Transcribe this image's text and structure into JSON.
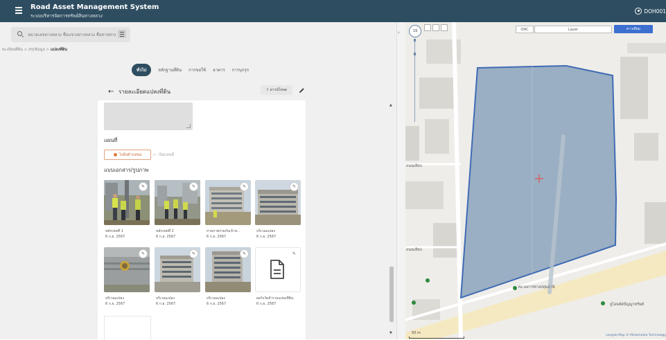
{
  "header": {
    "title": "Road Asset Management System",
    "subtitle": "ระบบบริหารจัดการทรัพย์สินทางหลวง",
    "user": "DOH001"
  },
  "search": {
    "placeholder": "หมายเลขทางหลวง ชื่อแขวงทางหลวง ชื่อสายทาง"
  },
  "breadcrumb": {
    "item1": "ทะเบียนที่ดิน",
    "sep": ">",
    "item2": "สรุปข้อมูล",
    "current": "แปลงที่ดิน"
  },
  "tabs": [
    {
      "label": "ทั่วไป",
      "active": true
    },
    {
      "label": "หลักฐานที่ดิน",
      "active": false
    },
    {
      "label": "การขอใช้",
      "active": false
    },
    {
      "label": "อาคาร",
      "active": false
    },
    {
      "label": "การบุกรุก",
      "active": false
    }
  ],
  "detail": {
    "title": "รายละเอียดแปลงที่ดิน",
    "export_label": "ดาวน์โหลด",
    "map_section": "แผนที่",
    "locate_btn": "ไปยังตำแหน่ง",
    "map_btn": "เปิดแผนที่",
    "doc_section": "แบบเอกสาร/รูปภาพ"
  },
  "photos": [
    {
      "name": "หลักเขตที่ 1",
      "date": "6 ก.ย. 2567",
      "kind": "people"
    },
    {
      "name": "หลักเขตที่ 2",
      "date": "6 ก.ย. 2567",
      "kind": "people"
    },
    {
      "name": "ถ่ายภาพร่วมกับเจ้าข...",
      "date": "6 ก.ย. 2567",
      "kind": "building"
    },
    {
      "name": "บริเวณแปลง",
      "date": "6 ก.ย. 2567",
      "kind": "building"
    },
    {
      "name": "บริเวณแปลง",
      "date": "6 ก.ย. 2567",
      "kind": "wall"
    },
    {
      "name": "บริเวณแปลง",
      "date": "6 ก.ย. 2567",
      "kind": "building"
    },
    {
      "name": "บริเวณแปลง",
      "date": "6 ก.ย. 2567",
      "kind": "building"
    },
    {
      "name": "ผลรังวัดสำรวจแปลงที่ดิน",
      "date": "6 ก.ย. 2567",
      "kind": "document"
    }
  ],
  "map": {
    "zoom": "19",
    "layer_label": "ONC",
    "layer_select": "Layer",
    "basemap_select": "ดาวเทียม",
    "labels": {
      "road1": "ถนนเลียบ",
      "road2": "ถนนเลียบ",
      "poi1": "หมวดการทางปทุมธานี",
      "poi2": "ยูไอพลัสปัญญาทรัพย์"
    },
    "scale": "50 m",
    "attribution": "Longdo Map © Metamedia Technology",
    "parcel_color": "#7e9ab5",
    "parcel_stroke": "#3f6bb5",
    "marker_color": "#e05050"
  },
  "colors": {
    "appbar": "#2e4d60",
    "accent": "#e07a3c"
  }
}
